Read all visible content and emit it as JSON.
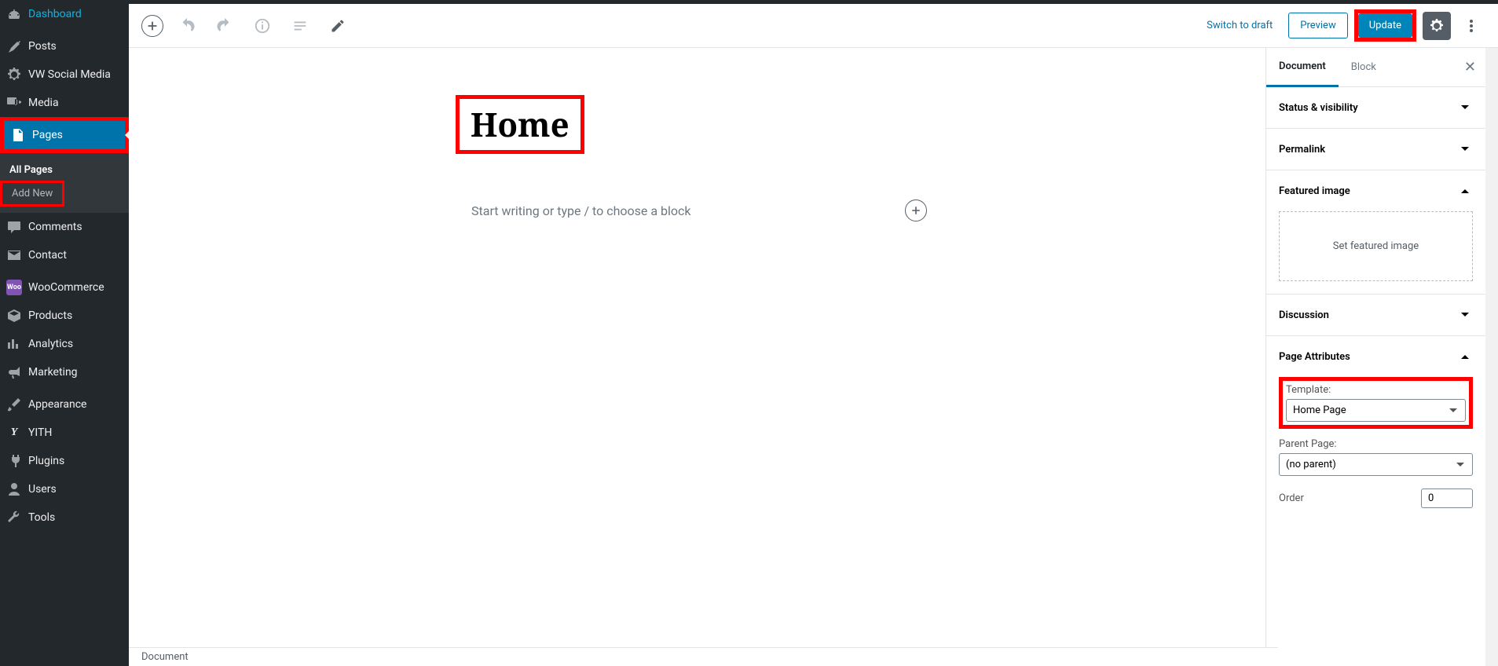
{
  "sidebar": {
    "items": [
      {
        "label": "Dashboard"
      },
      {
        "label": "Posts"
      },
      {
        "label": "VW Social Media"
      },
      {
        "label": "Media"
      },
      {
        "label": "Pages"
      },
      {
        "label": "Comments"
      },
      {
        "label": "Contact"
      },
      {
        "label": "WooCommerce"
      },
      {
        "label": "Products"
      },
      {
        "label": "Analytics"
      },
      {
        "label": "Marketing"
      },
      {
        "label": "Appearance"
      },
      {
        "label": "YITH"
      },
      {
        "label": "Plugins"
      },
      {
        "label": "Users"
      },
      {
        "label": "Tools"
      }
    ],
    "submenu": {
      "all_pages": "All Pages",
      "add_new": "Add New"
    }
  },
  "toolbar": {
    "switch_draft": "Switch to draft",
    "preview": "Preview",
    "update": "Update"
  },
  "editor": {
    "title": "Home",
    "placeholder": "Start writing or type / to choose a block"
  },
  "inspector": {
    "tabs": {
      "document": "Document",
      "block": "Block"
    },
    "panels": {
      "status": "Status & visibility",
      "permalink": "Permalink",
      "featured": "Featured image",
      "featured_btn": "Set featured image",
      "discussion": "Discussion",
      "page_attributes": "Page Attributes",
      "template_label": "Template:",
      "template_value": "Home Page",
      "parent_label": "Parent Page:",
      "parent_value": "(no parent)",
      "order_label": "Order",
      "order_value": "0"
    }
  },
  "breadcrumb": "Document"
}
